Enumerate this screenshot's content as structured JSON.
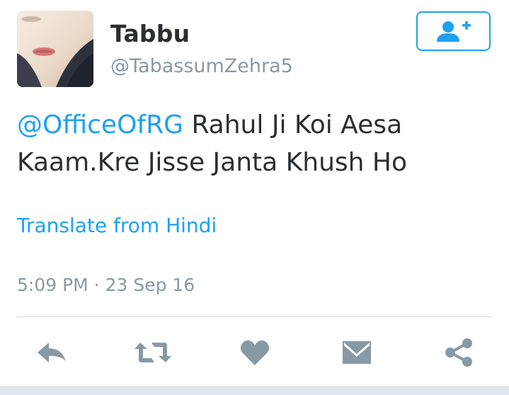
{
  "user": {
    "display_name": "Tabbu",
    "handle": "@TabassumZehra5"
  },
  "follow_button": {
    "icon": "follow-user-plus-icon"
  },
  "tweet": {
    "mention": "@OfficeOfRG",
    "text_line1": " Rahul Ji Koi Aesa",
    "text_line2": "Kaam.Kre Jisse Janta Khush Ho"
  },
  "translate": {
    "label": "Translate from Hindi"
  },
  "meta": {
    "timestamp": "5:09 PM · 23 Sep 16"
  },
  "actions": {
    "icons": [
      "reply-icon",
      "retweet-icon",
      "like-heart-icon",
      "direct-message-icon",
      "share-icon"
    ]
  },
  "colors": {
    "accent": "#1da1f2",
    "text": "#292f33",
    "muted": "#8899a6",
    "icon_gray": "#8899a6"
  }
}
